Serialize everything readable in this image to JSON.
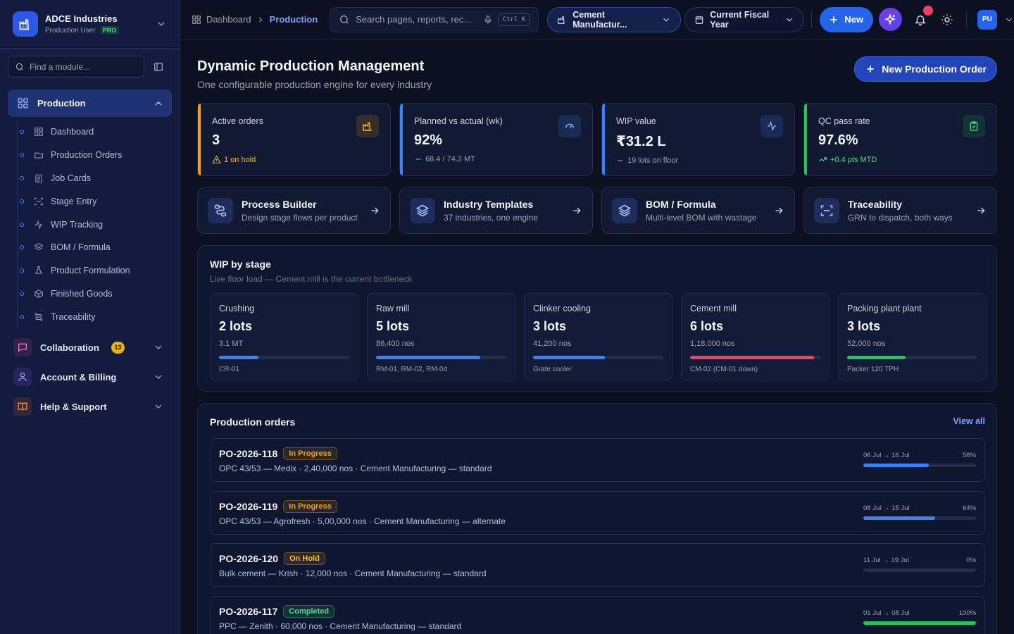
{
  "brand": {
    "name": "ADCE Industries",
    "role": "Production User",
    "plan": "PRO"
  },
  "sidebar": {
    "find_placeholder": "Find a module...",
    "active_section": "Production",
    "items": [
      {
        "label": "Dashboard",
        "icon": "grid-icon"
      },
      {
        "label": "Production Orders",
        "icon": "folder-icon"
      },
      {
        "label": "Job Cards",
        "icon": "clipboard-icon"
      },
      {
        "label": "Stage Entry",
        "icon": "scan-icon"
      },
      {
        "label": "WIP Tracking",
        "icon": "activity-icon"
      },
      {
        "label": "BOM / Formula",
        "icon": "layers-icon"
      },
      {
        "label": "Product Formulation",
        "icon": "flask-icon"
      },
      {
        "label": "Finished Goods",
        "icon": "box-icon"
      },
      {
        "label": "Traceability",
        "icon": "route-icon"
      }
    ],
    "groups": [
      {
        "label": "Collaboration",
        "badge": "13",
        "color": "#ec4899"
      },
      {
        "label": "Account & Billing",
        "color": "#8b5cf6"
      },
      {
        "label": "Help & Support",
        "color": "#f97316"
      }
    ]
  },
  "topbar": {
    "breadcrumb": [
      "Dashboard",
      "Production"
    ],
    "search_placeholder": "Search pages, reports, rec...",
    "shortcut": "Ctrl K",
    "industry": "Cement Manufactur...",
    "period": "Current Fiscal Year",
    "new_label": "New",
    "avatar": "PU"
  },
  "page": {
    "title": "Dynamic Production Management",
    "subtitle": "One configurable production engine for every industry",
    "primary_action": "New Production Order"
  },
  "kpis": [
    {
      "label": "Active orders",
      "value": "3",
      "note": "1 on hold",
      "accent": "#f59e0b",
      "note_color": "#fbbf24",
      "note_icon": "warning-icon"
    },
    {
      "label": "Planned vs actual (wk)",
      "value": "92%",
      "note": "68.4 / 74.2 MT",
      "accent": "#3b82f6",
      "note_color": "#9ca3af",
      "note_icon": "dash-icon"
    },
    {
      "label": "WIP value",
      "value": "₹31.2 L",
      "note": "19 lots on floor",
      "accent": "#3b82f6",
      "note_color": "#9ca3af",
      "note_icon": "dash-icon"
    },
    {
      "label": "QC pass rate",
      "value": "97.6%",
      "note": "+0.4 pts MTD",
      "accent": "#22c55e",
      "note_color": "#4ade80",
      "note_icon": "trend-up-icon"
    }
  ],
  "tiles": [
    {
      "title": "Process Builder",
      "desc": "Design stage flows per product"
    },
    {
      "title": "Industry Templates",
      "desc": "37 industries, one engine"
    },
    {
      "title": "BOM / Formula",
      "desc": "Multi-level BOM with wastage"
    },
    {
      "title": "Traceability",
      "desc": "GRN to dispatch, both ways"
    }
  ],
  "wip": {
    "title": "WIP by stage",
    "subtitle": "Live floor load — Cement mill is the current bottleneck",
    "stages": [
      {
        "name": "Crushing",
        "lots": "2 lots",
        "qty": "3.1 MT",
        "meta": "CR-01",
        "load": 0.3,
        "color": "#3b82f6"
      },
      {
        "name": "Raw mill",
        "lots": "5 lots",
        "qty": "86,400 nos",
        "meta": "RM-01, RM-02, RM-04",
        "load": 0.8,
        "color": "#3b82f6"
      },
      {
        "name": "Clinker cooling",
        "lots": "3 lots",
        "qty": "41,200 nos",
        "meta": "Grate cooler",
        "load": 0.55,
        "color": "#3b82f6"
      },
      {
        "name": "Cement mill",
        "lots": "6 lots",
        "qty": "1,18,000 nos",
        "meta": "CM-02 (CM-01 down)",
        "load": 0.95,
        "color": "#f43f5e"
      },
      {
        "name": "Packing plant plant",
        "lots": "3 lots",
        "qty": "52,000 nos",
        "meta": "Packer 120 TPH",
        "load": 0.45,
        "color": "#22c55e"
      }
    ]
  },
  "orders": {
    "title": "Production orders",
    "view_all": "View all",
    "rows": [
      {
        "id": "PO-2026-118",
        "status": "In Progress",
        "desc": "OPC 43/53 — Medix · 2,40,000 nos · Cement Manufacturing — standard",
        "dates": "06 Jul → 16 Jul",
        "pct_label": "58%",
        "progress": 0.58,
        "bar_color": "#3b82f6",
        "status_color": "#f59e0b"
      },
      {
        "id": "PO-2026-119",
        "status": "In Progress",
        "desc": "OPC 43/53 — Agrofresh · 5,00,000 nos · Cement Manufacturing — alternate",
        "dates": "08 Jul → 15 Jul",
        "pct_label": "64%",
        "progress": 0.64,
        "bar_color": "#3b82f6",
        "status_color": "#f59e0b"
      },
      {
        "id": "PO-2026-120",
        "status": "On Hold",
        "desc": "Bulk cement — Krish · 12,000 nos · Cement Manufacturing — standard",
        "dates": "11 Jul → 19 Jul",
        "pct_label": "0%",
        "progress": 0,
        "bar_color": "#3b82f6",
        "status_color": "#fbbf24"
      },
      {
        "id": "PO-2026-117",
        "status": "Completed",
        "desc": "PPC — Zenith · 60,000 nos · Cement Manufacturing — standard",
        "dates": "01 Jul → 08 Jul",
        "pct_label": "100%",
        "progress": 1,
        "bar_color": "#22c55e",
        "status_color": "#4ade80"
      }
    ]
  }
}
